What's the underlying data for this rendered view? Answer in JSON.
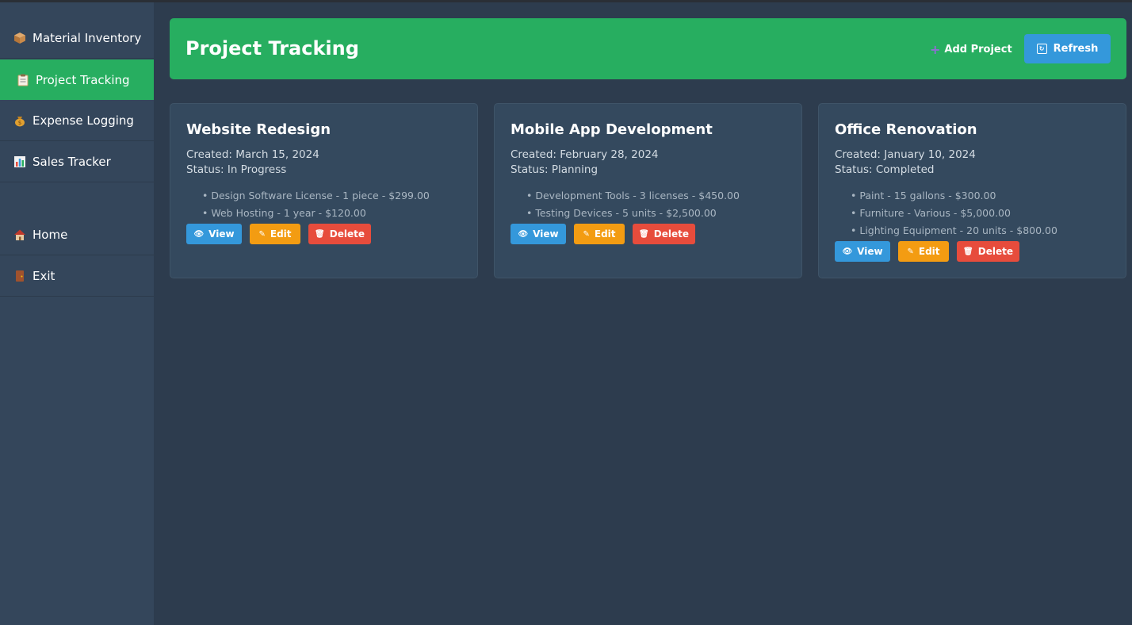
{
  "sidebar": {
    "items": [
      {
        "label": "Material Inventory",
        "icon": "package-icon"
      },
      {
        "label": "Project Tracking",
        "icon": "clipboard-icon"
      },
      {
        "label": "Expense Logging",
        "icon": "money-bag-icon"
      },
      {
        "label": "Sales Tracker",
        "icon": "bar-chart-icon"
      },
      {
        "label": "Home",
        "icon": "home-icon"
      },
      {
        "label": "Exit",
        "icon": "door-icon"
      }
    ],
    "active": "Project Tracking"
  },
  "header": {
    "title": "Project Tracking",
    "add_label": "Add Project",
    "refresh_label": "Refresh"
  },
  "projects": [
    {
      "title": "Website Redesign",
      "created": "Created: March 15, 2024",
      "status": "Status: In Progress",
      "items": [
        "Design Software License - 1 piece - $299.00",
        "Web Hosting - 1 year - $120.00"
      ]
    },
    {
      "title": "Mobile App Development",
      "created": "Created: February 28, 2024",
      "status": "Status: Planning",
      "items": [
        "Development Tools - 3 licenses - $450.00",
        "Testing Devices - 5 units - $2,500.00"
      ]
    },
    {
      "title": "Office Renovation",
      "created": "Created: January 10, 2024",
      "status": "Status: Completed",
      "items": [
        "Paint - 15 gallons - $300.00",
        "Furniture - Various - $5,000.00",
        "Lighting Equipment - 20 units - $800.00"
      ]
    }
  ],
  "actions": {
    "view": "View",
    "edit": "Edit",
    "delete": "Delete"
  },
  "colors": {
    "accent_green": "#27ae60",
    "view_blue": "#3498db",
    "edit_orange": "#f39c12",
    "delete_red": "#e74c3c"
  }
}
